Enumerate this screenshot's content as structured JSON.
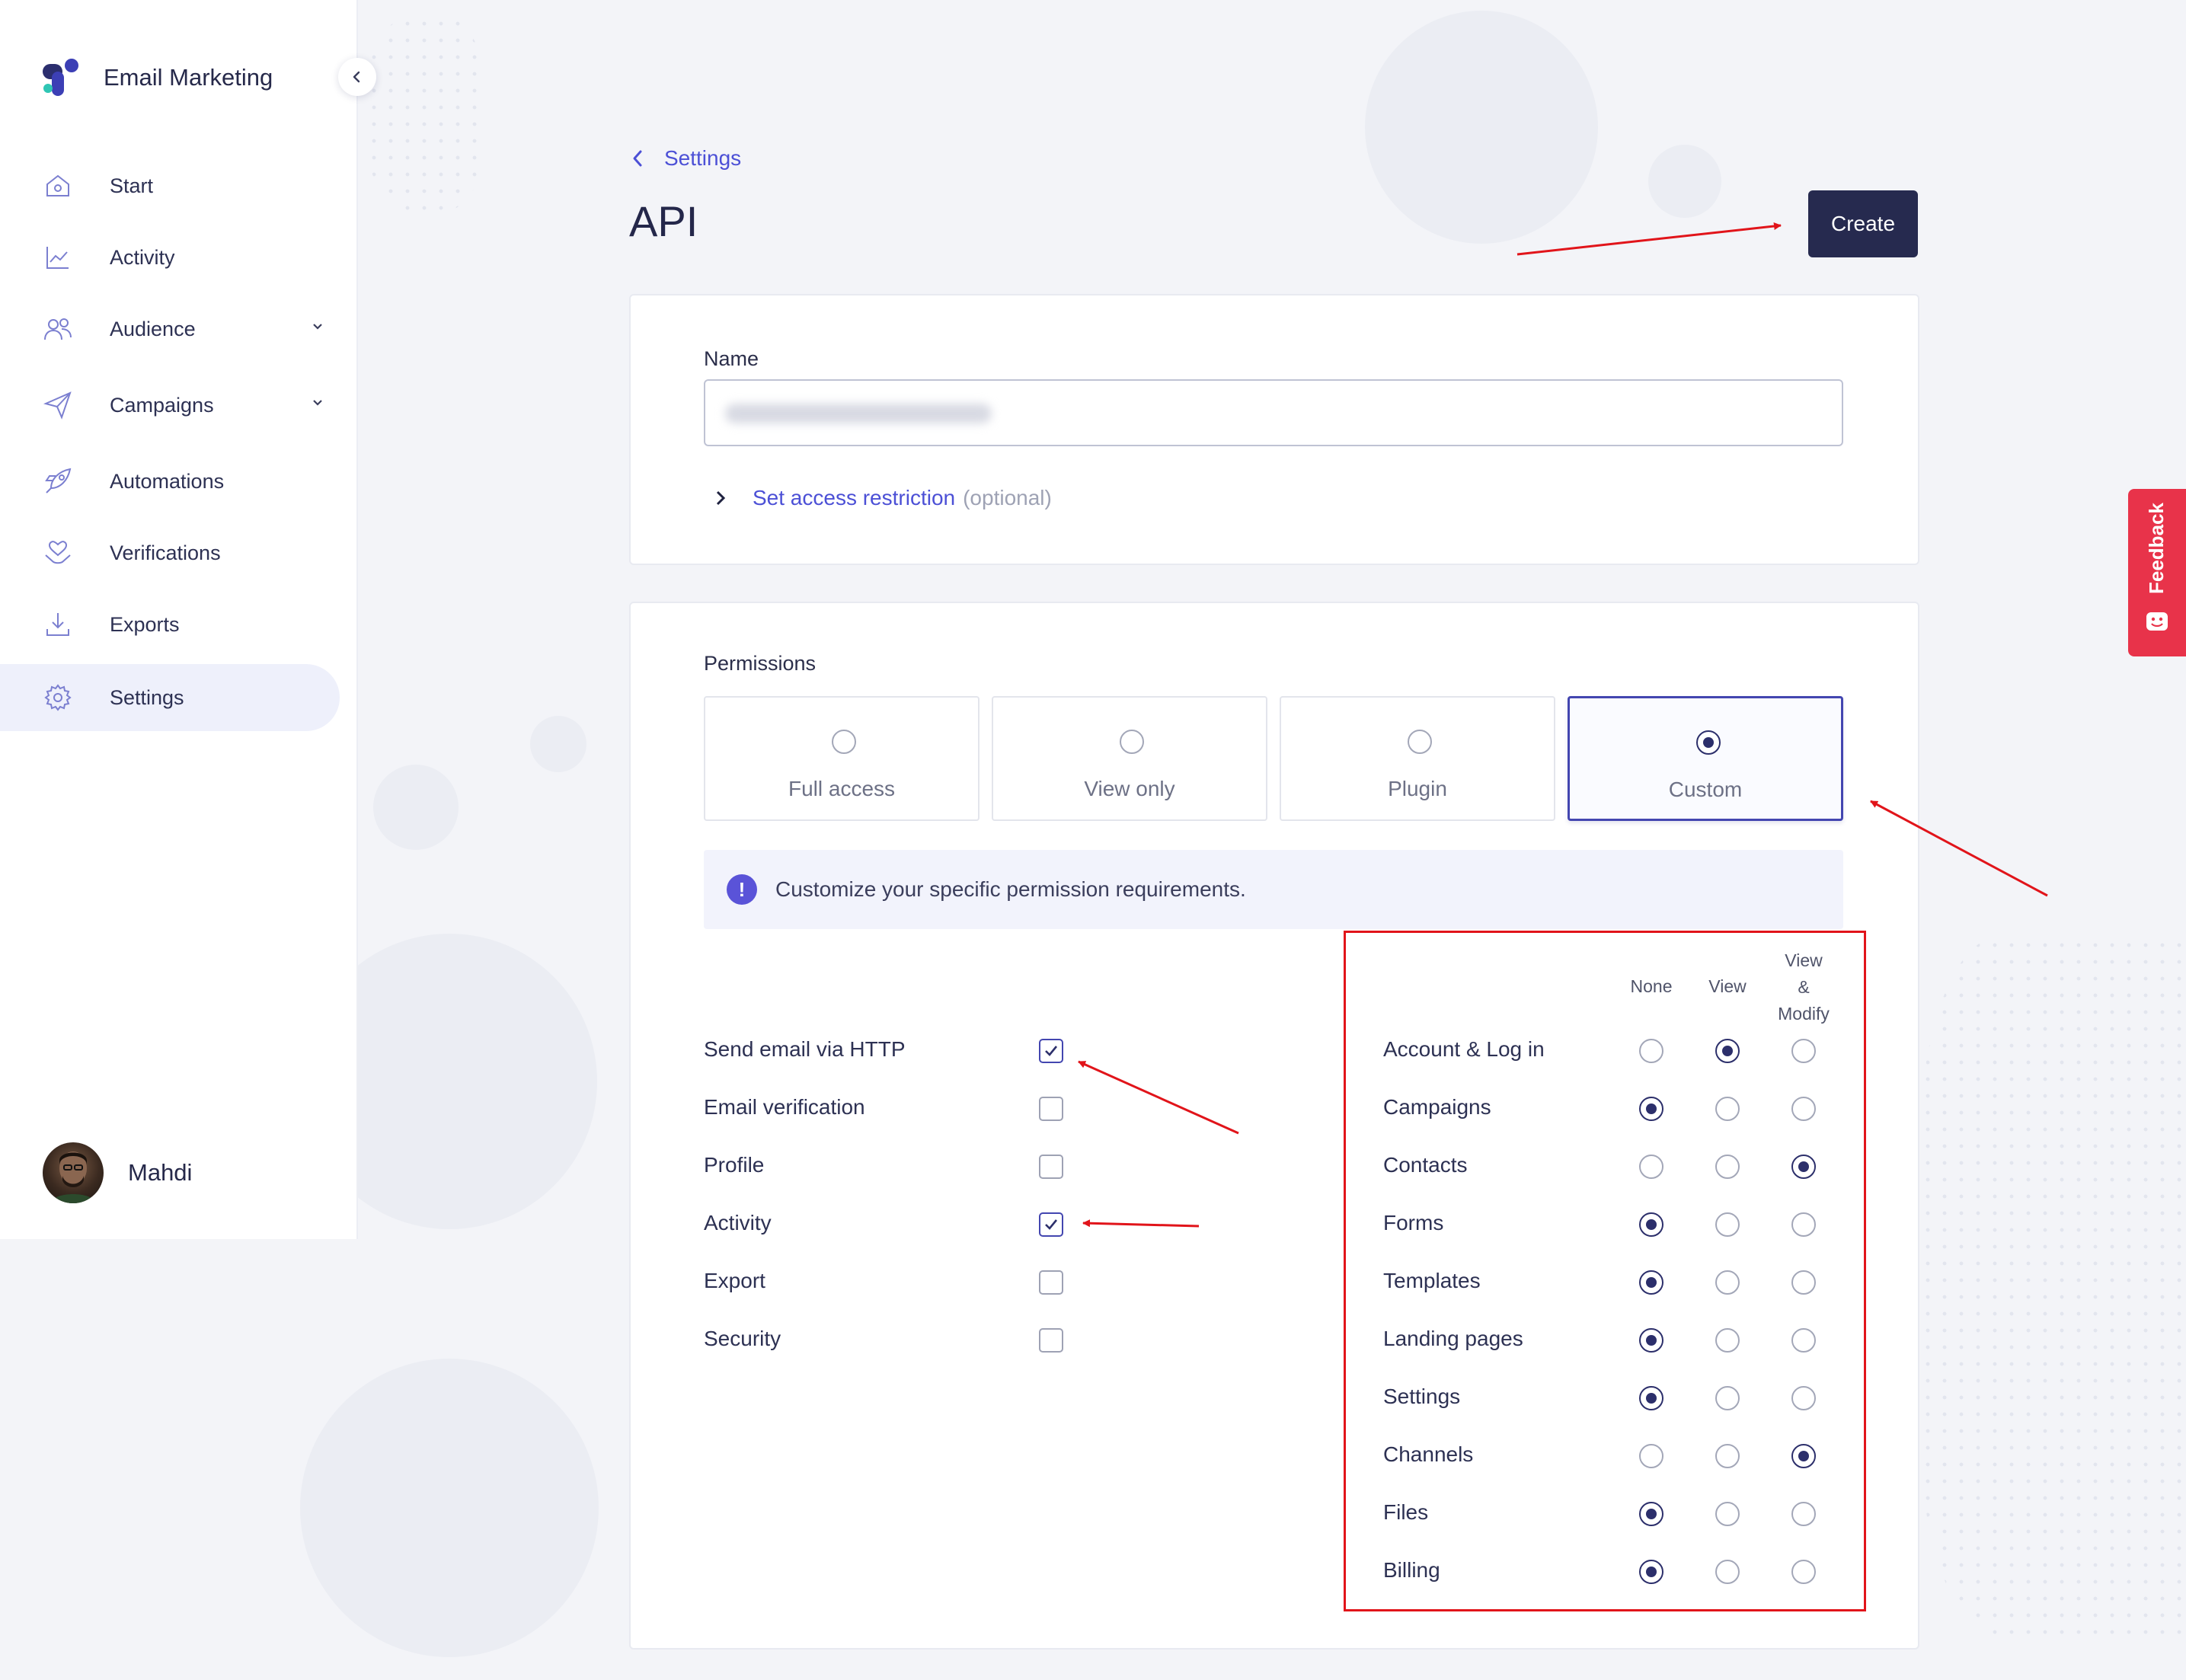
{
  "app": {
    "name": "Email Marketing"
  },
  "sidebar": {
    "items": [
      {
        "label": "Start",
        "icon": "home-icon"
      },
      {
        "label": "Activity",
        "icon": "chart-line-icon"
      },
      {
        "label": "Audience",
        "icon": "users-icon",
        "expandable": true
      },
      {
        "label": "Campaigns",
        "icon": "paper-plane-icon",
        "expandable": true
      },
      {
        "label": "Automations",
        "icon": "rocket-icon"
      },
      {
        "label": "Verifications",
        "icon": "heart-hand-icon"
      },
      {
        "label": "Exports",
        "icon": "download-icon"
      },
      {
        "label": "Settings",
        "icon": "gear-icon",
        "active": true
      }
    ],
    "user": {
      "name": "Mahdi"
    }
  },
  "header": {
    "breadcrumb": "Settings",
    "title": "API",
    "create_label": "Create"
  },
  "name_card": {
    "label": "Name",
    "value": "",
    "restriction_link": "Set access restriction",
    "restriction_optional": "(optional)"
  },
  "permissions": {
    "label": "Permissions",
    "options": [
      {
        "label": "Full access",
        "selected": false
      },
      {
        "label": "View only",
        "selected": false
      },
      {
        "label": "Plugin",
        "selected": false
      },
      {
        "label": "Custom",
        "selected": true
      }
    ],
    "info": "Customize your specific permission requirements.",
    "checkboxes": [
      {
        "label": "Send email via HTTP",
        "checked": true
      },
      {
        "label": "Email verification",
        "checked": false
      },
      {
        "label": "Profile",
        "checked": false
      },
      {
        "label": "Activity",
        "checked": true
      },
      {
        "label": "Export",
        "checked": false
      },
      {
        "label": "Security",
        "checked": false
      }
    ],
    "matrix": {
      "columns": [
        "None",
        "View",
        "View\n&\nModify"
      ],
      "rows": [
        {
          "label": "Account & Log in",
          "value": 1
        },
        {
          "label": "Campaigns",
          "value": 0
        },
        {
          "label": "Contacts",
          "value": 2
        },
        {
          "label": "Forms",
          "value": 0
        },
        {
          "label": "Templates",
          "value": 0
        },
        {
          "label": "Landing pages",
          "value": 0
        },
        {
          "label": "Settings",
          "value": 0
        },
        {
          "label": "Channels",
          "value": 2
        },
        {
          "label": "Files",
          "value": 0
        },
        {
          "label": "Billing",
          "value": 0
        }
      ]
    }
  },
  "feedback": {
    "label": "Feedback"
  },
  "colors": {
    "accent": "#4c50d6",
    "primary_button": "#262a4f",
    "annotation": "#e1141a",
    "feedback": "#e8334a"
  }
}
